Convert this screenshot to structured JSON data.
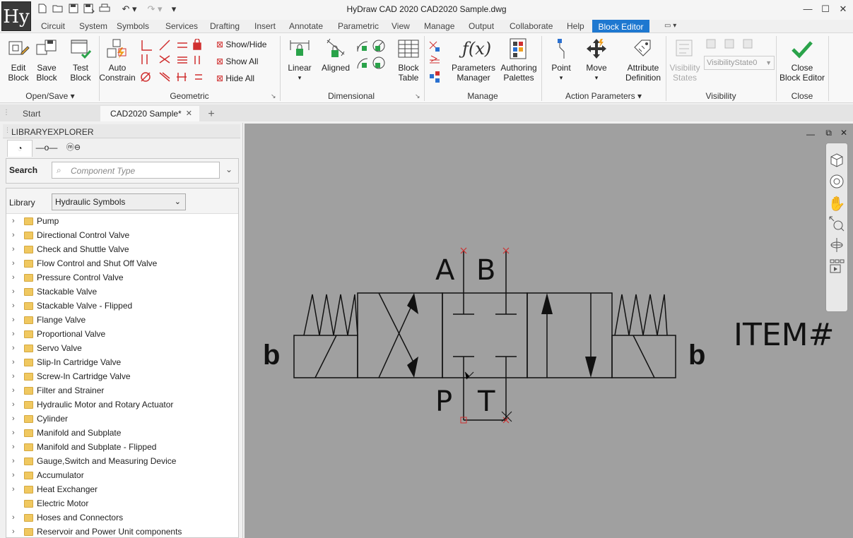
{
  "app": {
    "title": "HyDraw CAD 2020    CAD2020 Sample.dwg",
    "logo": "Hy"
  },
  "menus": [
    "Circuit",
    "System",
    "Symbols",
    "Services",
    "Drafting",
    "Insert",
    "Annotate",
    "Parametric",
    "View",
    "Manage",
    "Output",
    "Collaborate",
    "Help",
    "Block Editor"
  ],
  "ribbon": {
    "open_save": {
      "label": "Open/Save",
      "edit_block": [
        "Edit",
        "Block"
      ],
      "save_block": [
        "Save",
        "Block"
      ],
      "test_block": [
        "Test",
        "Block"
      ]
    },
    "geometric": {
      "label": "Geometric",
      "auto_constrain": [
        "Auto",
        "Constrain"
      ],
      "show_hide": "Show/Hide",
      "show_all": "Show All",
      "hide_all": "Hide All"
    },
    "dimensional": {
      "label": "Dimensional",
      "linear": "Linear",
      "aligned": "Aligned",
      "block_table": [
        "Block",
        "Table"
      ]
    },
    "manage": {
      "label": "Manage",
      "parameters_manager": [
        "Parameters",
        "Manager"
      ],
      "authoring_palettes": [
        "Authoring",
        "Palettes"
      ]
    },
    "action_parameters": {
      "label": "Action Parameters",
      "point": "Point",
      "move": "Move",
      "attribute_definition": [
        "Attribute",
        "Definition"
      ]
    },
    "visibility": {
      "label": "Visibility",
      "visibility_states": [
        "Visibility",
        "States"
      ],
      "state_select": "VisibilityState0"
    },
    "close": {
      "label": "Close",
      "close_block_editor": [
        "Close",
        "Block Editor"
      ]
    }
  },
  "doc_tabs": {
    "start": "Start",
    "sample": "CAD2020 Sample*",
    "close_glyph": "✕",
    "add_glyph": "+"
  },
  "library": {
    "panel_title": "LIBRARYEXPLORER",
    "search_label": "Search",
    "search_placeholder": "Component Type",
    "library_label": "Library",
    "library_value": "Hydraulic Symbols",
    "items": [
      {
        "label": "Pump",
        "expandable": true
      },
      {
        "label": "Directional Control Valve",
        "expandable": true
      },
      {
        "label": "Check and Shuttle Valve",
        "expandable": true
      },
      {
        "label": "Flow Control and Shut Off Valve",
        "expandable": true
      },
      {
        "label": "Pressure Control Valve",
        "expandable": true
      },
      {
        "label": "Stackable Valve",
        "expandable": true
      },
      {
        "label": "Stackable Valve - Flipped",
        "expandable": true
      },
      {
        "label": "Flange Valve",
        "expandable": true
      },
      {
        "label": "Proportional Valve",
        "expandable": true
      },
      {
        "label": "Servo Valve",
        "expandable": true
      },
      {
        "label": "Slip-In Cartridge Valve",
        "expandable": true
      },
      {
        "label": "Screw-In Cartridge Valve",
        "expandable": true
      },
      {
        "label": "Filter and Strainer",
        "expandable": true
      },
      {
        "label": "Hydraulic Motor and Rotary Actuator",
        "expandable": true
      },
      {
        "label": "Cylinder",
        "expandable": true
      },
      {
        "label": "Manifold and Subplate",
        "expandable": true
      },
      {
        "label": "Manifold and Subplate - Flipped",
        "expandable": true
      },
      {
        "label": "Gauge,Switch and Measuring Device",
        "expandable": true
      },
      {
        "label": "Accumulator",
        "expandable": true
      },
      {
        "label": "Heat Exchanger",
        "expandable": true
      },
      {
        "label": "Electric Motor",
        "expandable": false
      },
      {
        "label": "Hoses and Connectors",
        "expandable": true
      },
      {
        "label": "Reservoir and Power Unit components",
        "expandable": true
      }
    ]
  },
  "drawing": {
    "port_a": "A",
    "port_b": "B",
    "port_p": "P",
    "port_t": "T",
    "solenoid_left": "b",
    "solenoid_right": "b",
    "item_label": "ITEM#"
  },
  "colors": {
    "accent": "#1e78d0",
    "canvas_bg": "#a0a0a0",
    "folder": "#f0c860",
    "check_green": "#2aa34a",
    "grip_red": "#d03030"
  }
}
